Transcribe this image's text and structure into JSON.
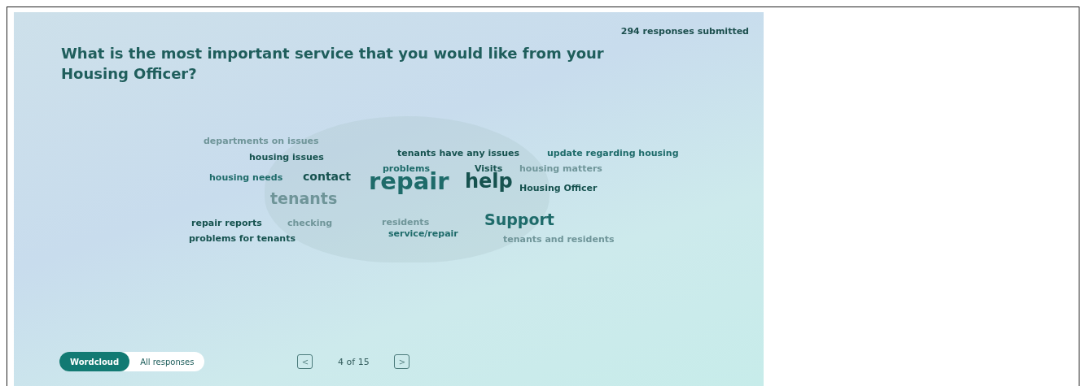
{
  "header": {
    "responses": "294 responses submitted"
  },
  "question": "What is the most important service that you would like from your Housing Officer?",
  "wordcloud": [
    {
      "text": "departments on issues",
      "kind": "small",
      "color": "#6f9599"
    },
    {
      "text": "housing issues",
      "kind": "small",
      "color": "#16524f"
    },
    {
      "text": "tenants have any issues",
      "kind": "small",
      "color": "#16524f"
    },
    {
      "text": "update regarding housing",
      "kind": "small",
      "color": "#1e6b6a"
    },
    {
      "text": "problems",
      "kind": "small",
      "color": "#1e6b6a"
    },
    {
      "text": "Visits",
      "kind": "small",
      "color": "#16524f"
    },
    {
      "text": "housing matters",
      "kind": "small",
      "color": "#6f9599"
    },
    {
      "text": "housing needs",
      "kind": "small",
      "color": "#1e6b6a"
    },
    {
      "text": "contact",
      "kind": "medium",
      "color": "#16524f"
    },
    {
      "text": "repair",
      "kind": "huge",
      "color": "#1e6b6a"
    },
    {
      "text": "help",
      "kind": "xlarge",
      "color": "#16524f"
    },
    {
      "text": "Housing Officer",
      "kind": "small",
      "color": "#16524f"
    },
    {
      "text": "tenants",
      "kind": "large",
      "color": "#6f9599"
    },
    {
      "text": "repair reports",
      "kind": "small",
      "color": "#16524f"
    },
    {
      "text": "checking",
      "kind": "small",
      "color": "#6f9599"
    },
    {
      "text": "residents",
      "kind": "small",
      "color": "#6f9599"
    },
    {
      "text": "Support",
      "kind": "large",
      "color": "#1e6b6a"
    },
    {
      "text": "problems for tenants",
      "kind": "small",
      "color": "#16524f"
    },
    {
      "text": "service/repair",
      "kind": "small",
      "color": "#1e6b6a"
    },
    {
      "text": "tenants and residents",
      "kind": "small",
      "color": "#6f9599"
    }
  ],
  "view_tabs": [
    {
      "label": "Wordcloud",
      "selected": true
    },
    {
      "label": "All responses",
      "selected": false
    }
  ],
  "pager": {
    "prev": "<",
    "position": "4 of 15",
    "next": ">"
  }
}
